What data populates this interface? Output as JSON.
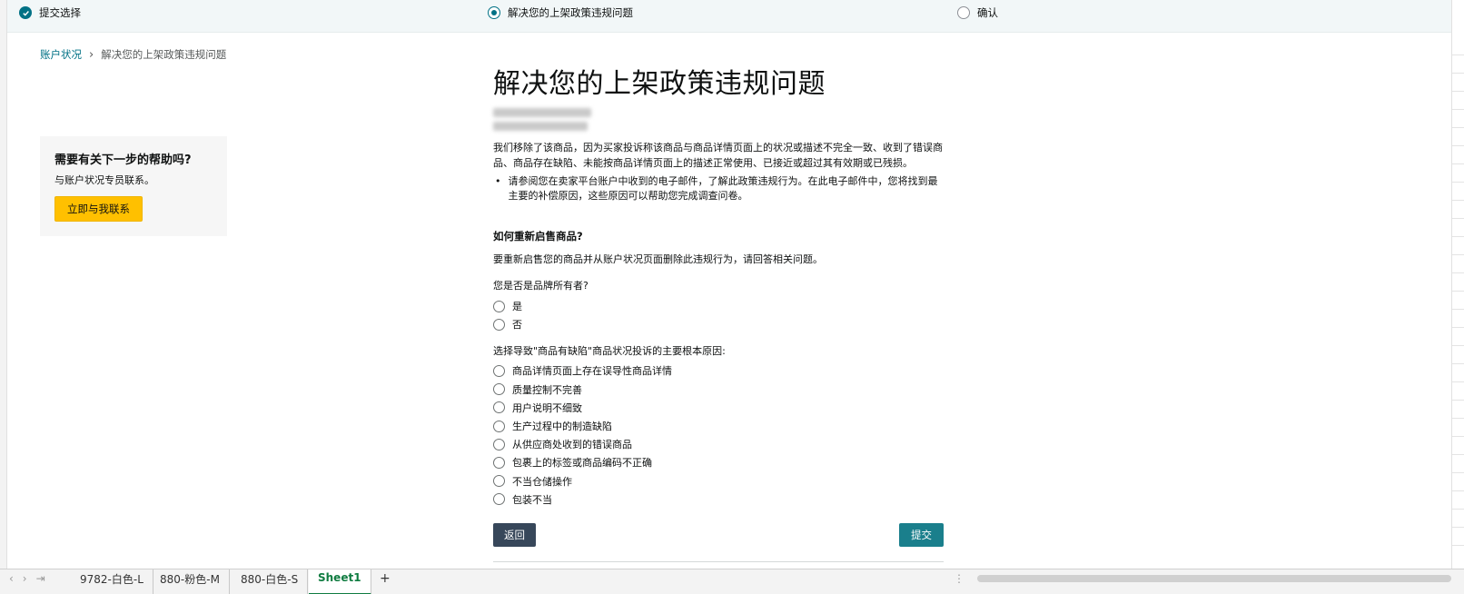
{
  "stepper": {
    "steps": [
      {
        "label": "提交选择",
        "state": "done"
      },
      {
        "label": "解决您的上架政策违规问题",
        "state": "active"
      },
      {
        "label": "确认",
        "state": "todo"
      }
    ]
  },
  "breadcrumb": {
    "parent": "账户状况",
    "current": "解决您的上架政策违规问题"
  },
  "help": {
    "title": "需要有关下一步的帮助吗?",
    "text": "与账户状况专员联系。",
    "button": "立即与我联系"
  },
  "main": {
    "title": "解决您的上架政策违规问题",
    "description": "我们移除了该商品，因为买家投诉称该商品与商品详情页面上的状况或描述不完全一致、收到了错误商品、商品存在缺陷、未能按商品详情页面上的描述正常使用、已接近或超过其有效期或已残损。",
    "bullet": "请参阅您在卖家平台账户中收到的电子邮件，了解此政策违规行为。在此电子邮件中，您将找到最主要的补偿原因，这些原因可以帮助您完成调查问卷。",
    "question_title": "如何重新启售商品?",
    "question_desc": "要重新启售您的商品并从账户状况页面删除此违规行为，请回答相关问题。",
    "q1_label": "您是否是品牌所有者?",
    "q1_options": [
      "是",
      "否"
    ],
    "q2_label": "选择导致\"商品有缺陷\"商品状况投诉的主要根本原因:",
    "q2_options": [
      "商品详情页面上存在误导性商品详情",
      "质量控制不完善",
      "用户说明不细致",
      "生产过程中的制造缺陷",
      "从供应商处收到的错误商品",
      "包裹上的标签或商品编码不正确",
      "不当仓储操作",
      "包装不当"
    ],
    "back_button": "返回",
    "submit_button": "提交"
  },
  "sheetbar": {
    "tabs": [
      "9782-白色-L",
      "880-粉色-M",
      "880-白色-S",
      "Sheet1"
    ],
    "active_tab": "Sheet1",
    "add": "+"
  },
  "colors": {
    "accent": "#007185",
    "help_button": "#ffc000",
    "back_button": "#37475a",
    "submit_button": "#1a7f8c"
  }
}
